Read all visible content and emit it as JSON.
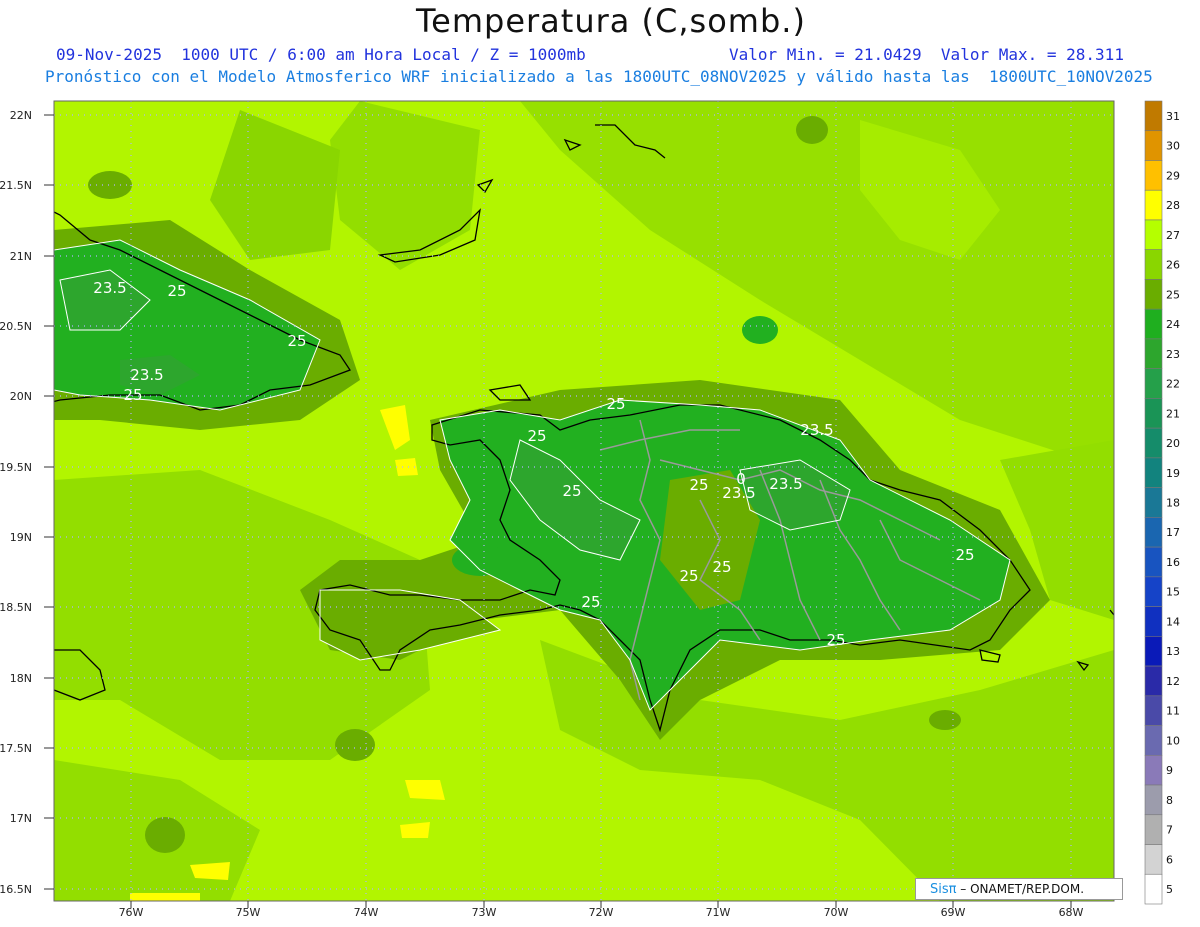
{
  "header": {
    "title": "Temperatura (C,somb.)",
    "line1": "09-Nov-2025  1000 UTC / 6:00 am Hora Local / Z = 1000mb",
    "line1_minmax": "Valor Min. = 21.0429  Valor Max. = 28.311",
    "line2": "Pronóstico con el Modelo Atmosferico WRF inicializado a las 1800UTC_08NOV2025 y válido hasta las  1800UTC_10NOV2025"
  },
  "axes": {
    "lat_labels": [
      "22N",
      "21.5N",
      "21N",
      "20.5N",
      "20N",
      "19.5N",
      "19N",
      "18.5N",
      "18N",
      "17.5N",
      "17N",
      "16.5N"
    ],
    "lon_labels": [
      "76W",
      "75W",
      "74W",
      "73W",
      "72W",
      "71W",
      "70W",
      "69W",
      "68W"
    ]
  },
  "contour_labels": [
    {
      "text": "23.5"
    },
    {
      "text": "25"
    },
    {
      "text": "25"
    },
    {
      "text": "23.5"
    },
    {
      "text": "25"
    },
    {
      "text": "25"
    },
    {
      "text": "25"
    },
    {
      "text": "23.5"
    },
    {
      "text": "25"
    },
    {
      "text": "0"
    },
    {
      "text": "23.5"
    },
    {
      "text": "23.5"
    },
    {
      "text": "25"
    },
    {
      "text": "25"
    },
    {
      "text": "25"
    },
    {
      "text": "25"
    },
    {
      "text": "25"
    },
    {
      "text": "25"
    }
  ],
  "colorbar": {
    "values": [
      "31",
      "30",
      "29",
      "28",
      "27",
      "26",
      "25",
      "24",
      "23",
      "22",
      "21",
      "20",
      "19",
      "18",
      "17",
      "16",
      "15",
      "14",
      "13",
      "12",
      "11",
      "10",
      "9",
      "8",
      "7",
      "6",
      "5"
    ],
    "colors": [
      "#c07a00",
      "#e09400",
      "#ffc000",
      "#ffff00",
      "#b5ff00",
      "#8ad600",
      "#6aad00",
      "#1faf1f",
      "#2da62d",
      "#25a04a",
      "#1a9456",
      "#158c6a",
      "#12837e",
      "#1a7896",
      "#1a66b0",
      "#1854c0",
      "#1543c8",
      "#1030c0",
      "#0a1ab8",
      "#2a2aa8",
      "#4a4aa8",
      "#6a6ab0",
      "#8a7ab8",
      "#9c9cac",
      "#b0b0b0",
      "#d3d3d3",
      "#ffffff"
    ]
  },
  "credit": {
    "logo": "Sisπ",
    "text": "– ONAMET/REP.DOM."
  }
}
